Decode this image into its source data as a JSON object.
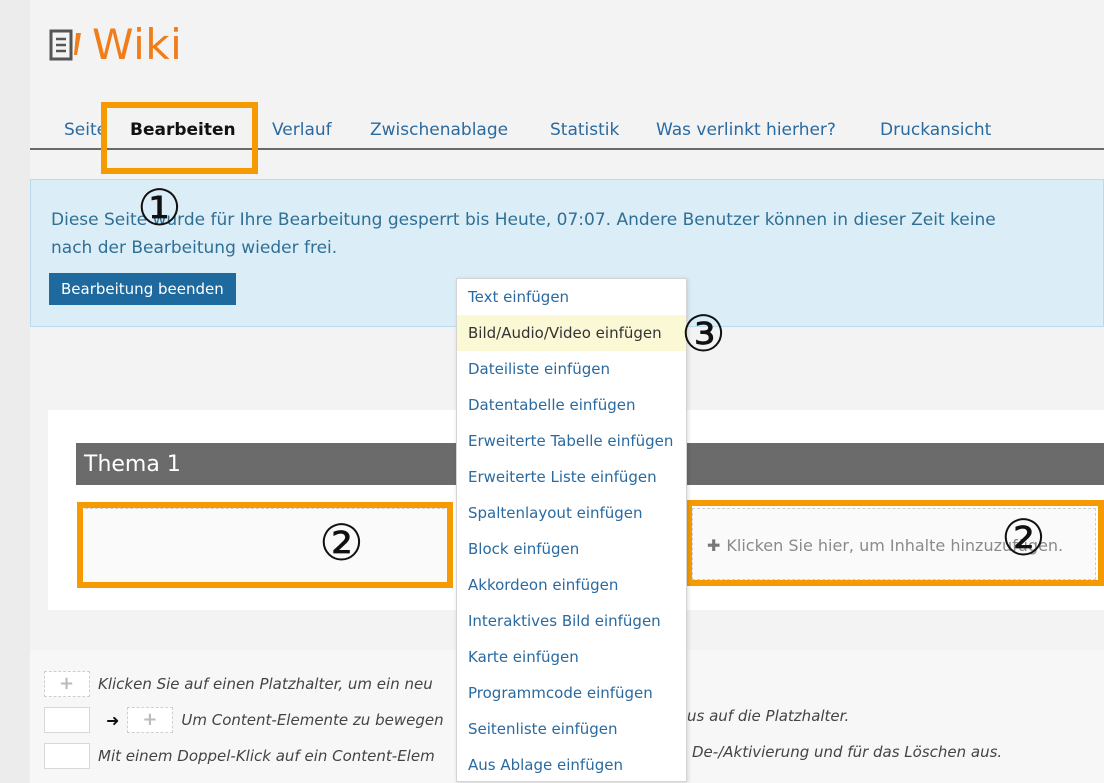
{
  "header": {
    "title": "Wiki",
    "icon": "wiki-page-icon"
  },
  "tabs": [
    {
      "label": "Seite"
    },
    {
      "label": "Bearbeiten",
      "active": true
    },
    {
      "label": "Verlauf"
    },
    {
      "label": "Zwischenablage"
    },
    {
      "label": "Statistik"
    },
    {
      "label": "Was verlinkt hierher?"
    },
    {
      "label": "Druckansicht"
    }
  ],
  "info": {
    "line1": "Diese Seite wurde für Ihre Bearbeitung gesperrt bis Heute, 07:07. Andere Benutzer können in dieser Zeit keine",
    "line2": "nach der Bearbeitung wieder frei.",
    "button": "Bearbeitung beenden"
  },
  "section": {
    "title": "Thema 1",
    "add_hint": "Klicken Sie hier, um Inhalte hinzuzufügen."
  },
  "menu": {
    "items": [
      "Text einfügen",
      "Bild/Audio/Video einfügen",
      "Dateiliste einfügen",
      "Datentabelle einfügen",
      "Erweiterte Tabelle einfügen",
      "Erweiterte Liste einfügen",
      "Spaltenlayout einfügen",
      "Block einfügen",
      "Akkordeon einfügen",
      "Interaktives Bild einfügen",
      "Karte einfügen",
      "Programmcode einfügen",
      "Seitenliste einfügen",
      "Aus Ablage einfügen"
    ],
    "highlighted_index": 1
  },
  "legend": {
    "row1": "Klicken Sie auf einen Platzhalter, um ein neu",
    "row2a": "Um Content-Elemente zu bewegen",
    "row2b": "us auf die Platzhalter.",
    "row3a": "Mit einem Doppel-Klick auf ein Content-Elem",
    "row3b": "De-/Aktivierung und für das Löschen aus."
  },
  "badges": {
    "one": "①",
    "two": "②",
    "three": "③"
  },
  "colors": {
    "highlight": "#f59a00",
    "accent": "#f07d1a",
    "link": "#2a6aa0",
    "info_bg": "#dbeef7",
    "button": "#1e6a9e"
  }
}
